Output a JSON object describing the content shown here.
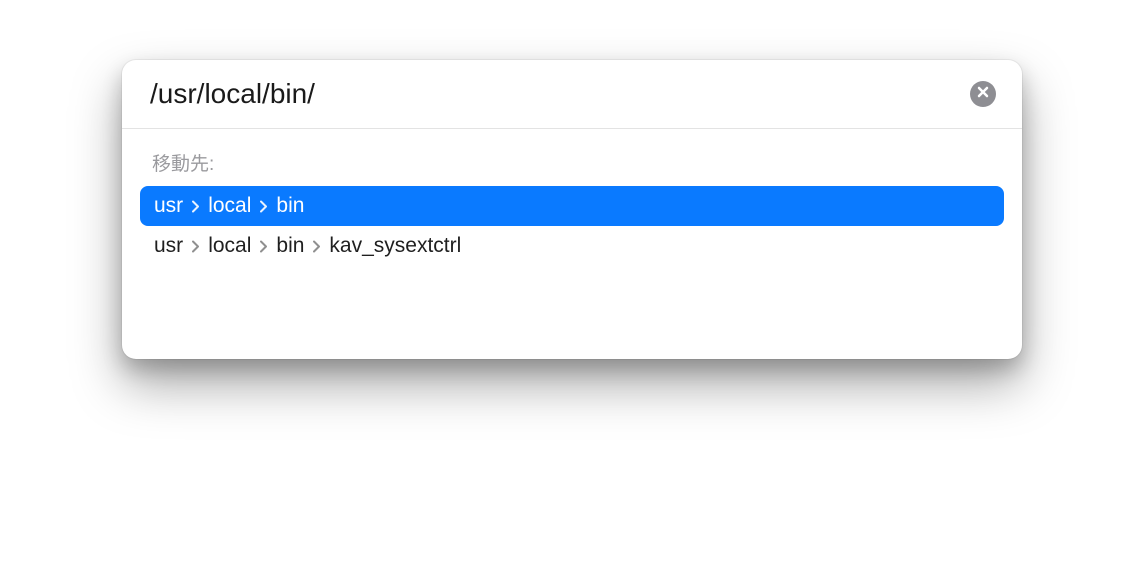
{
  "input": {
    "value": "/usr/local/bin/"
  },
  "section_label": "移動先:",
  "results": [
    {
      "segments": [
        "usr",
        "local",
        "bin"
      ],
      "selected": true
    },
    {
      "segments": [
        "usr",
        "local",
        "bin",
        "kav_sysextctrl"
      ],
      "selected": false
    }
  ]
}
